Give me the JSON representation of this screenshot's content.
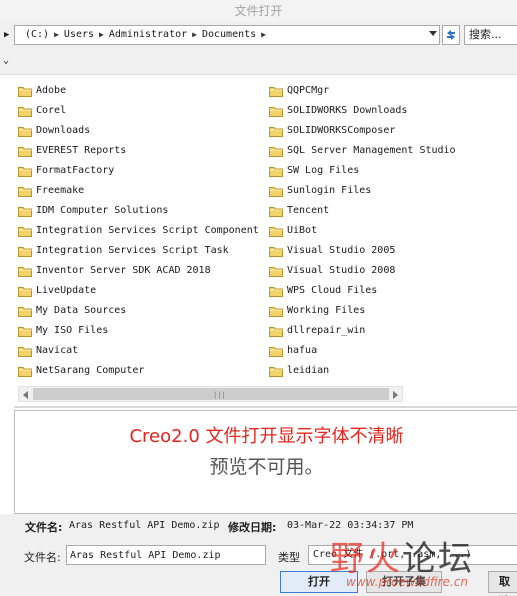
{
  "window": {
    "title": "文件打开"
  },
  "address": {
    "crumbs": [
      "(C:)",
      "Users",
      "Administrator",
      "Documents"
    ],
    "search_placeholder": "搜索..."
  },
  "files": {
    "left": [
      "Adobe",
      "Corel",
      "Downloads",
      "EVEREST Reports",
      "FormatFactory",
      "Freemake",
      "IDM Computer Solutions",
      "Integration Services Script Component",
      "Integration Services Script Task",
      "Inventor Server SDK ACAD 2018",
      "LiveUpdate",
      "My Data Sources",
      "My ISO Files",
      "Navicat",
      "NetSarang Computer"
    ],
    "right": [
      "QQPCMgr",
      "SOLIDWORKS Downloads",
      "SOLIDWORKSComposer",
      "SQL Server Management Studio",
      "SW Log Files",
      "Sunlogin Files",
      "Tencent",
      "UiBot",
      "Visual Studio 2005",
      "Visual Studio 2008",
      "WPS Cloud Files",
      "Working Files",
      "dllrepair_win",
      "hafua",
      "leidian"
    ]
  },
  "preview": {
    "caption": "Creo2.0 文件打开显示字体不清晰",
    "unavailable": "预览不可用。"
  },
  "info": {
    "filename_label": "文件名:",
    "filename_value": "Aras Restful API Demo.zip",
    "modified_label": "修改日期:",
    "modified_value": "03-Mar-22 03:34:37 PM"
  },
  "form": {
    "name_label": "文件名:",
    "name_value": "Aras Restful API Demo.zip",
    "type_label": "类型",
    "type_value": "Creo 文件 (.prt, .asm, ...)"
  },
  "buttons": {
    "open": "打开",
    "middle": "打开子集",
    "cancel": "取消"
  },
  "watermark": {
    "text_red": "野火",
    "text_dark": "论坛",
    "url": "www.proewildfire.cn"
  },
  "colors": {
    "caption": "#e8241c",
    "folder": "#f2d36b",
    "open_button_border": "#3c7fd1"
  }
}
